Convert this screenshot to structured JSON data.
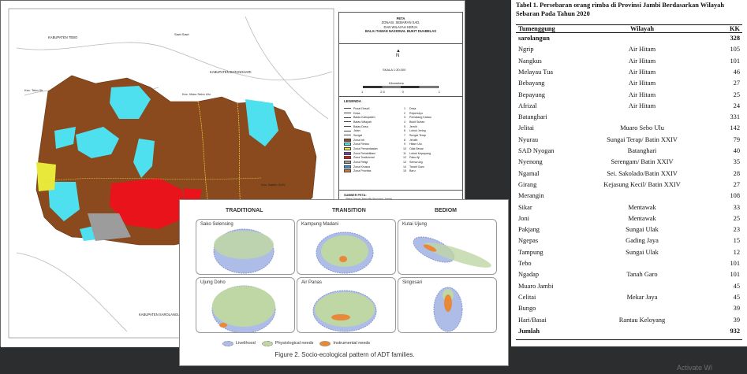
{
  "map": {
    "title_lines": [
      "PETA",
      "ZONASI, SEBARAN SAD,",
      "DAN WILAYAH KERJA",
      "BALAI TAMAN NASIONAL BUKIT DUABELAS"
    ],
    "north": "N",
    "scale_label": "SKALA 1:30.000",
    "scale_unit": "Kilometers",
    "scale_ticks": [
      "1",
      "2.5",
      "0",
      "",
      "1"
    ],
    "legend_title": "LEGENDA",
    "legend_left": [
      {
        "label": "Pusat Desa/i",
        "color": "#ffffff"
      },
      {
        "label": "Desa",
        "color": "#ffffff"
      },
      {
        "label": "Batas Kabupaten",
        "color": "#ffffff"
      },
      {
        "label": "Batas Wilayah",
        "color": "#ffffff"
      },
      {
        "label": "Batas Desa",
        "color": "#ffffff"
      },
      {
        "label": "Jalan",
        "color": "#ffffff"
      },
      {
        "label": "Sungai",
        "color": "#ffffff"
      },
      {
        "label": "Zona Inti",
        "color": "#8a4a1e"
      },
      {
        "label": "Zona Rimba",
        "color": "#4fe0ef"
      },
      {
        "label": "Zona Pemanfaatan",
        "color": "#e8e83a"
      },
      {
        "label": "Zona Rehabilitasi",
        "color": "#7a3fa0"
      },
      {
        "label": "Zona Tradisional",
        "color": "#e8131b"
      },
      {
        "label": "Zona Religi",
        "color": "#9c9c9c"
      },
      {
        "label": "Zona Khusus",
        "color": "#3a8fd8"
      },
      {
        "label": "Zona Prioritas",
        "color": "#c77c2a"
      }
    ],
    "legend_right": [
      {
        "num": "1",
        "label": "Desa"
      },
      {
        "num": "2",
        "label": "Rejomulyo"
      },
      {
        "num": "3",
        "label": "Pematang Kabau"
      },
      {
        "num": "4",
        "label": "Bukit Suban"
      },
      {
        "num": "5",
        "label": "Jernih"
      },
      {
        "num": "6",
        "label": "Lubuk Jering"
      },
      {
        "num": "7",
        "label": "Sungai Terap"
      },
      {
        "num": "8",
        "label": "Jelutih"
      },
      {
        "num": "9",
        "label": "Hitam Ulu"
      },
      {
        "num": "10",
        "label": "Olak Besar"
      },
      {
        "num": "11",
        "label": "Lubuk Kepayang"
      },
      {
        "num": "12",
        "label": "Paku Aji"
      },
      {
        "num": "13",
        "label": "Semurung"
      },
      {
        "num": "14",
        "label": "Tanah Garo"
      },
      {
        "num": "15",
        "label": "Baru"
      }
    ],
    "sources_title": "SUMBER PETA:",
    "sources": [
      "- Peta Dasar Tematik Provinsi Jambi",
      "- Lampiran Peta SK 3508/Menhut-II/2014",
      "- Peta Dasar Tematik Kehutanan Provinsi Jambi",
      "- Data Sensus SAD 2018"
    ],
    "inset_title": "PETA SITUASI",
    "labels": [
      {
        "text": "KABUPATEN TEBO"
      },
      {
        "text": "KABUPATEN BATANGHARI"
      },
      {
        "text": "KABUPATEN SAROLANGUN"
      },
      {
        "text": "Kec. Tebo Ilir"
      },
      {
        "text": "Kec. Maro Sebo Ulu"
      },
      {
        "text": "Kec. Bathin XXIV"
      },
      {
        "text": "Sawi Sawi"
      }
    ]
  },
  "figure2": {
    "columns": [
      "TRADITIONAL",
      "TRANSITION",
      "BEDIOM"
    ],
    "cells": [
      {
        "label": "Sako Selensing"
      },
      {
        "label": "Kampung Madani"
      },
      {
        "label": "Kutai Ujung"
      },
      {
        "label": "Ujung Doho"
      },
      {
        "label": "Air Panas"
      },
      {
        "label": "Singosari"
      }
    ],
    "legend": [
      "Livelihood",
      "Physiological needs",
      "Instrumental needs"
    ],
    "caption": "Figure 2. Socio-ecological pattern of ADT families."
  },
  "table": {
    "title": "Tabel 1. Persebaran orang rimba di Provinsi Jambi Berdasarkan Wilayah Sebaran Pada Tahun 2020",
    "headers": [
      "Tumenggung",
      "Wilayah",
      "KK"
    ],
    "rows": [
      {
        "name": "sarolangun",
        "region": "",
        "kk": "328",
        "bold": true
      },
      {
        "name": "Ngrip",
        "region": "Air Hitam",
        "kk": "105"
      },
      {
        "name": "Nangkus",
        "region": "Air Hitam",
        "kk": "101"
      },
      {
        "name": "Melayau Tua",
        "region": "Air Hitam",
        "kk": "46"
      },
      {
        "name": "Bebayang",
        "region": "Air Hitam",
        "kk": "27"
      },
      {
        "name": "Bepayung",
        "region": "Air Hitam",
        "kk": "25"
      },
      {
        "name": "Afrizal",
        "region": "Air Hitam",
        "kk": "24"
      },
      {
        "name": "Batanghari",
        "region": "",
        "kk": "331"
      },
      {
        "name": "Jelitai",
        "region": "Muaro Sebo Ulu",
        "kk": "142"
      },
      {
        "name": "Nyurau",
        "region": "Sungai Terap/ Batin XXIV",
        "kk": "79"
      },
      {
        "name": "SAD Nyogan",
        "region": "Batanghari",
        "kk": "40"
      },
      {
        "name": "Nyenong",
        "region": "Serengam/ Batin XXIV",
        "kk": "35"
      },
      {
        "name": "Ngamal",
        "region": "Sei. Sakolado/Batin XXIV",
        "kk": "28"
      },
      {
        "name": "Girang",
        "region": "Kejasung Kecil/ Batin XXIV",
        "kk": "27"
      },
      {
        "name": "Merangin",
        "region": "",
        "kk": "108"
      },
      {
        "name": "Sikar",
        "region": "Mentawak",
        "kk": "33"
      },
      {
        "name": "Joni",
        "region": "Mentawak",
        "kk": "25"
      },
      {
        "name": "Pakjang",
        "region": "Sungai Ulak",
        "kk": "23"
      },
      {
        "name": "Ngepas",
        "region": "Gading Jaya",
        "kk": "15"
      },
      {
        "name": "Tampung",
        "region": "Sungai Ulak",
        "kk": "12"
      },
      {
        "name": "Tebo",
        "region": "",
        "kk": "101"
      },
      {
        "name": "Ngadap",
        "region": "Tanah Garo",
        "kk": "101"
      },
      {
        "name": "Muaro Jambi",
        "region": "",
        "kk": "45"
      },
      {
        "name": "Celitai",
        "region": "Mekar Jaya",
        "kk": "45"
      },
      {
        "name": "Bungo",
        "region": "",
        "kk": "39"
      },
      {
        "name": "Hari/Basai",
        "region": "Rantau Keloyang",
        "kk": "39"
      },
      {
        "name": "Jumlah",
        "region": "",
        "kk": "932",
        "bold": true
      }
    ]
  },
  "watermark": "Activate Wi"
}
